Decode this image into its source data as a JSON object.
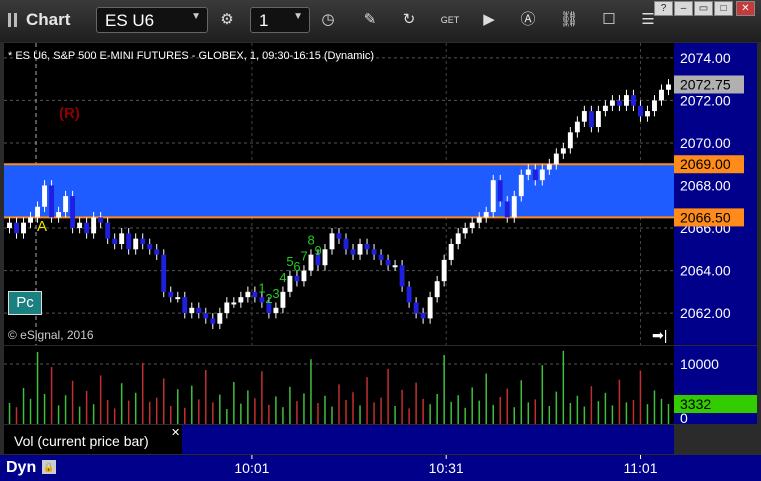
{
  "window": {
    "title": "Chart",
    "symbol_field": "ES U6",
    "interval_field": "1"
  },
  "colors": {
    "background": "#000000",
    "axis_bg": "#00008b",
    "zone_fill": "#1e5cff",
    "zone_border": "#ff8c1a",
    "up_bar": "#ffffff",
    "down_bar": "#1f1fe0",
    "vol_up": "#3fbf3f",
    "vol_down": "#c03030",
    "vol_current": "#33cc00"
  },
  "chart_data": {
    "type": "candlestick",
    "title": "* ES U6, S&P 500 E-MINI FUTURES - GLOBEX, 1, 09:30-16:15 (Dynamic)",
    "copyright": "© eSignal, 2016",
    "ylim": [
      2060.5,
      2074.7
    ],
    "y_ticks": [
      "2074.00",
      "2072.00",
      "2070.00",
      "2068.00",
      "2066.00",
      "2064.00",
      "2062.00"
    ],
    "x_ticks": [
      "10:01",
      "10:31",
      "11:01"
    ],
    "grid": true,
    "zone": {
      "upper": "2069.00",
      "lower": "2066.50"
    },
    "last_price": "2072.75",
    "markers": {
      "r_label": "(R)",
      "a_label": "A",
      "pc_label": "Pc",
      "td_counts": [
        "1",
        "2",
        "3",
        "4",
        "5",
        "6",
        "7",
        "8",
        "9"
      ]
    },
    "closes": [
      2066.25,
      2065.75,
      2066.25,
      2066.5,
      2067.0,
      2068.0,
      2066.5,
      2066.75,
      2067.5,
      2066.0,
      2066.25,
      2065.75,
      2066.5,
      2066.25,
      2065.5,
      2065.25,
      2065.75,
      2065.0,
      2065.5,
      2065.25,
      2065.0,
      2064.75,
      2063.0,
      2062.75,
      2062.75,
      2062.0,
      2062.25,
      2062.0,
      2061.75,
      2061.5,
      2062.0,
      2062.5,
      2062.5,
      2062.75,
      2063.0,
      2062.75,
      2062.5,
      2062.0,
      2062.25,
      2063.0,
      2063.75,
      2063.5,
      2064.0,
      2064.75,
      2064.25,
      2065.0,
      2065.75,
      2065.5,
      2065.0,
      2064.75,
      2065.25,
      2065.0,
      2064.75,
      2064.5,
      2064.25,
      2064.25,
      2063.25,
      2062.5,
      2062.0,
      2061.75,
      2062.75,
      2063.5,
      2064.5,
      2065.25,
      2065.75,
      2066.0,
      2066.25,
      2066.5,
      2066.75,
      2068.25,
      2067.25,
      2066.5,
      2067.5,
      2068.5,
      2068.75,
      2068.25,
      2068.75,
      2069.0,
      2069.5,
      2069.75,
      2070.5,
      2071.0,
      2071.5,
      2070.75,
      2071.5,
      2071.75,
      2072.0,
      2071.75,
      2072.25,
      2071.75,
      2071.25,
      2071.5,
      2072.0,
      2072.5,
      2072.75
    ],
    "volume": {
      "ylim": [
        0,
        13000
      ],
      "y_ticks": [
        "10000",
        "0"
      ],
      "current": "3332",
      "legend": "Vol (current price bar)",
      "values": [
        3500,
        2800,
        6000,
        4200,
        12000,
        5000,
        9500,
        3100,
        4800,
        7200,
        2900,
        5500,
        3300,
        8100,
        4000,
        2600,
        6800,
        3900,
        5200,
        10200,
        3700,
        4400,
        7600,
        3000,
        5800,
        2700,
        6400,
        4100,
        9000,
        3600,
        4900,
        2500,
        7000,
        3400,
        5600,
        4300,
        8800,
        3200,
        4600,
        2800,
        6200,
        3800,
        5100,
        10800,
        3500,
        4700,
        2900,
        6600,
        4000,
        5300,
        3100,
        7800,
        3600,
        4400,
        9200,
        3000,
        5700,
        2600,
        6900,
        4200,
        3300,
        5000,
        11500,
        3700,
        4800,
        2700,
        6100,
        3900,
        8400,
        3200,
        4500,
        5900,
        2800,
        7300,
        3600,
        4100,
        9800,
        3000,
        5400,
        12200,
        3500,
        4700,
        2900,
        6300,
        3800,
        5200,
        3100,
        7400,
        3600,
        4000,
        8900,
        3300,
        5600,
        4200,
        3332
      ]
    }
  },
  "time_axis": {
    "label": "Dyn"
  }
}
